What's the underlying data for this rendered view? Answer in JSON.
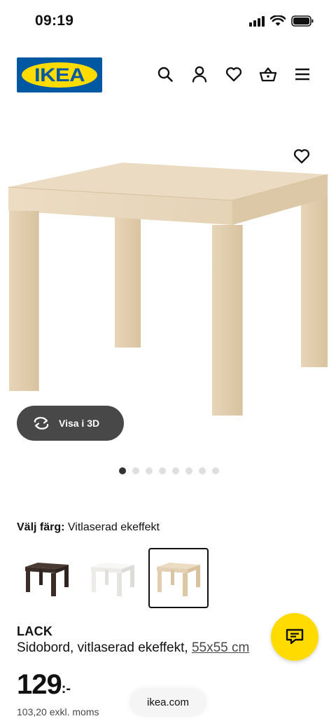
{
  "status_bar": {
    "time": "09:19"
  },
  "header": {
    "logo_text": "IKEA",
    "icons": [
      "search-icon",
      "account-icon",
      "heart-icon",
      "basket-icon",
      "menu-icon"
    ]
  },
  "product_gallery": {
    "view_3d_label": "Visa i 3D",
    "dot_count": 8,
    "active_index": 0
  },
  "color_picker": {
    "label": "Välj färg:",
    "selected_value": "Vitlaserad ekeffekt",
    "options": [
      "black-brown",
      "white",
      "white-stained-oak"
    ],
    "selected_index": 2
  },
  "product": {
    "name": "LACK",
    "description": "Sidobord, vitlaserad ekeffekt,",
    "size_link": "55x55 cm",
    "price_integer": "129",
    "price_suffix": ":-",
    "price_ex_vat": "103,20 exkl. moms"
  },
  "browser": {
    "url": "ikea.com"
  },
  "colors": {
    "ikea_blue": "#0058a3",
    "ikea_yellow": "#ffdb00",
    "dark_pill": "#484848",
    "oak": "#e8d8bf"
  }
}
